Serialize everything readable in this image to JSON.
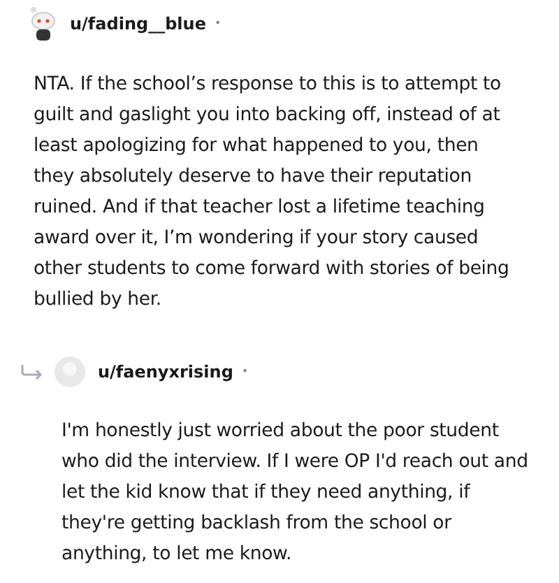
{
  "comments": [
    {
      "username": "u/fading__blue",
      "separator": "•",
      "reply": false,
      "kind": "snoo",
      "body": "NTA. If the school’s response to this is to attempt to guilt and gaslight you into backing off, instead of at least apologizing for what happened to you, then they absolutely deserve to have their reputation ruined. And if that teacher lost a lifetime teaching award over it, I’m wondering if your story caused other students to come forward with stories of being bullied by her."
    },
    {
      "username": "u/faenyxrising",
      "separator": "•",
      "reply": true,
      "kind": "blank",
      "body": "I'm honestly just worried about the poor student who did the interview. If I were OP I'd reach out and let the kid know that if they need anything, if they're getting backlash from the school or anything, to let me know."
    }
  ]
}
